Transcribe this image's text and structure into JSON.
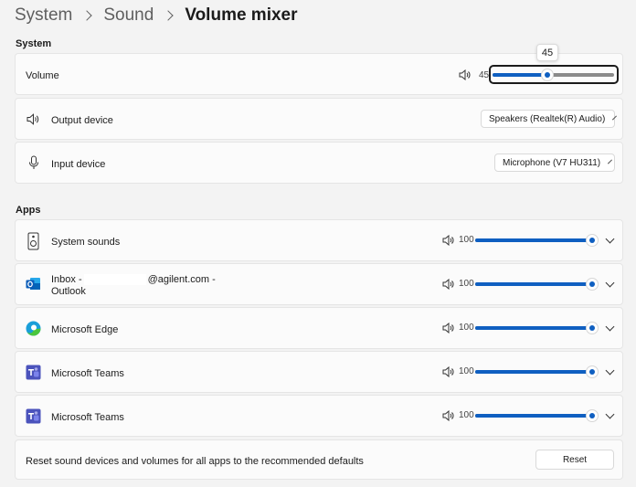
{
  "breadcrumb": {
    "items": [
      "System",
      "Sound",
      "Volume mixer"
    ]
  },
  "system_section": {
    "heading": "System",
    "volume": {
      "label": "Volume",
      "value": "45",
      "level": 45,
      "tooltip": "45"
    },
    "output": {
      "label": "Output device",
      "selected": "Speakers (Realtek(R) Audio)"
    },
    "input": {
      "label": "Input device",
      "selected": "Microphone (V7 HU311)"
    }
  },
  "apps_section": {
    "heading": "Apps",
    "apps": [
      {
        "name": "System sounds",
        "volume": "100",
        "level": 100,
        "icon": "speaker-device-icon"
      },
      {
        "name_line1_prefix": "Inbox -",
        "name_line1_suffix": "@agilent.com -",
        "name_line2": "Outlook",
        "volume": "100",
        "level": 100,
        "icon": "outlook-icon"
      },
      {
        "name": "Microsoft Edge",
        "volume": "100",
        "level": 100,
        "icon": "edge-icon"
      },
      {
        "name": "Microsoft Teams",
        "volume": "100",
        "level": 100,
        "icon": "teams-icon"
      },
      {
        "name": "Microsoft Teams",
        "volume": "100",
        "level": 100,
        "icon": "teams-icon"
      }
    ]
  },
  "reset": {
    "description": "Reset sound devices and volumes for all apps to the recommended defaults",
    "button_label": "Reset"
  },
  "colors": {
    "accent": "#0f5fc1",
    "background": "#f3f3f3",
    "card": "#fbfbfb"
  }
}
